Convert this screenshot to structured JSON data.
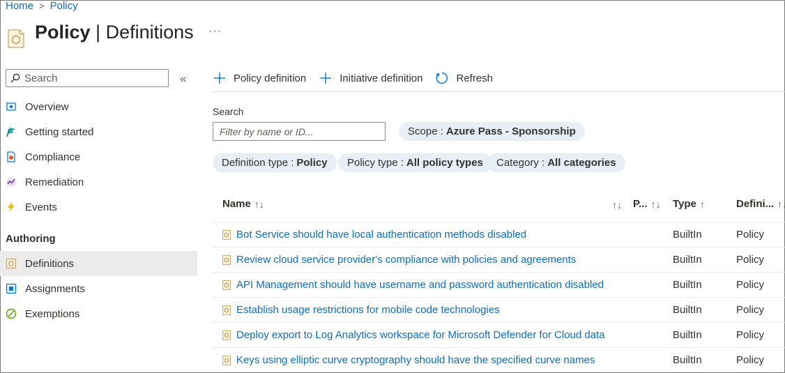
{
  "breadcrumb": {
    "home": "Home",
    "current": "Policy"
  },
  "title": {
    "main": "Policy",
    "separator": " | ",
    "sub": "Definitions",
    "more": "···"
  },
  "sidebar": {
    "search_placeholder": "Search",
    "collapse": "«",
    "items": [
      {
        "label": "Overview",
        "icon": "overview-icon"
      },
      {
        "label": "Getting started",
        "icon": "getting-started-icon"
      },
      {
        "label": "Compliance",
        "icon": "compliance-icon"
      },
      {
        "label": "Remediation",
        "icon": "remediation-icon"
      },
      {
        "label": "Events",
        "icon": "lightning-icon"
      }
    ],
    "section": "Authoring",
    "authoring_items": [
      {
        "label": "Definitions",
        "icon": "definitions-icon",
        "selected": true
      },
      {
        "label": "Assignments",
        "icon": "assignments-icon"
      },
      {
        "label": "Exemptions",
        "icon": "exemptions-icon"
      }
    ]
  },
  "toolbar": {
    "policy_definition": "Policy definition",
    "initiative_definition": "Initiative definition",
    "refresh": "Refresh"
  },
  "filters": {
    "search_label": "Search",
    "search_placeholder": "Filter by name or ID...",
    "scope_label": "Scope :",
    "scope_value": "Azure Pass - Sponsorship",
    "definition_type_label": "Definition type :",
    "definition_type_value": "Policy",
    "policy_type_label": "Policy type :",
    "policy_type_value": "All policy types",
    "category_label": "Category :",
    "category_value": "All categories"
  },
  "table": {
    "columns": {
      "name": "Name",
      "name_sort": "↑↓",
      "unnamed_sort": "↑↓",
      "p": "P...",
      "p_sort": "↑↓",
      "type": "Type",
      "type_sort": "↑",
      "definition": "Defini...",
      "definition_sort": "↑↓"
    },
    "rows": [
      {
        "name": "Bot Service should have local authentication methods disabled",
        "type": "BuiltIn",
        "definition": "Policy"
      },
      {
        "name": "Review cloud service provider's compliance with policies and agreements",
        "type": "BuiltIn",
        "definition": "Policy"
      },
      {
        "name": "API Management should have username and password authentication disabled",
        "type": "BuiltIn",
        "definition": "Policy"
      },
      {
        "name": "Establish usage restrictions for mobile code technologies",
        "type": "BuiltIn",
        "definition": "Policy"
      },
      {
        "name": "Deploy export to Log Analytics workspace for Microsoft Defender for Cloud data",
        "type": "BuiltIn",
        "definition": "Policy"
      },
      {
        "name": "Keys using elliptic curve cryptography should have the specified curve names",
        "type": "BuiltIn",
        "definition": "Policy"
      }
    ]
  },
  "colors": {
    "link": "#0f6cbd",
    "pill_bg": "#e8eef6",
    "selected_bg": "#ebebeb",
    "accent": "#0078d4"
  }
}
